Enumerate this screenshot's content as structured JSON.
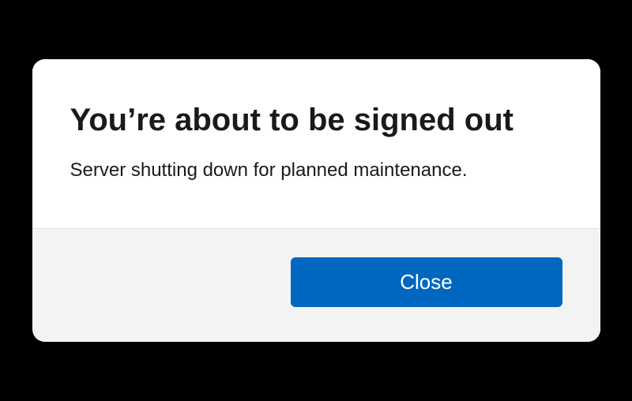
{
  "dialog": {
    "title": "You’re about to be signed out",
    "message": "Server shutting down for planned maintenance.",
    "close_label": "Close"
  }
}
